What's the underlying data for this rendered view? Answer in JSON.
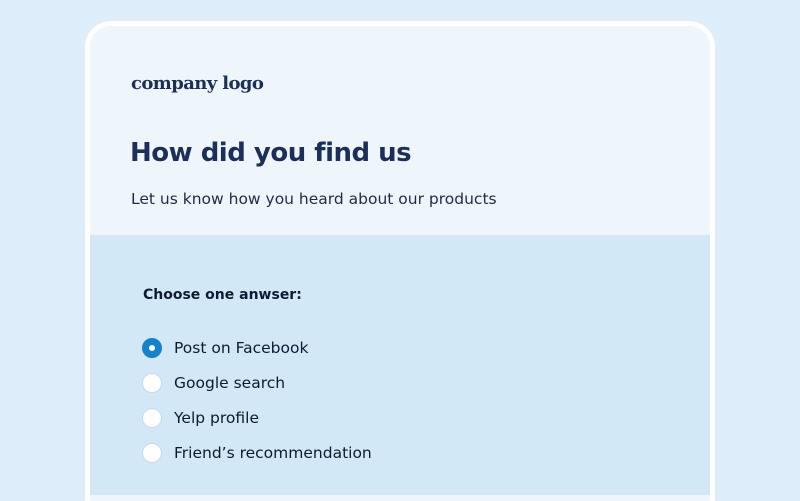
{
  "logo": {
    "text": "company logo"
  },
  "header": {
    "title": "How did you find us",
    "subtitle": "Let us know how you heard about our products"
  },
  "form": {
    "question": "Choose one anwser:",
    "options": [
      {
        "label": "Post on Facebook",
        "selected": true
      },
      {
        "label": "Google search",
        "selected": false
      },
      {
        "label": "Yelp profile",
        "selected": false
      },
      {
        "label": "Friend’s recommendation",
        "selected": false
      }
    ]
  },
  "colors": {
    "page_background": "#ddeefa",
    "card_header": "#eef6fc",
    "card_body": "#d3e8f7",
    "heading": "#1a2f5a",
    "accent": "#1582d0"
  }
}
